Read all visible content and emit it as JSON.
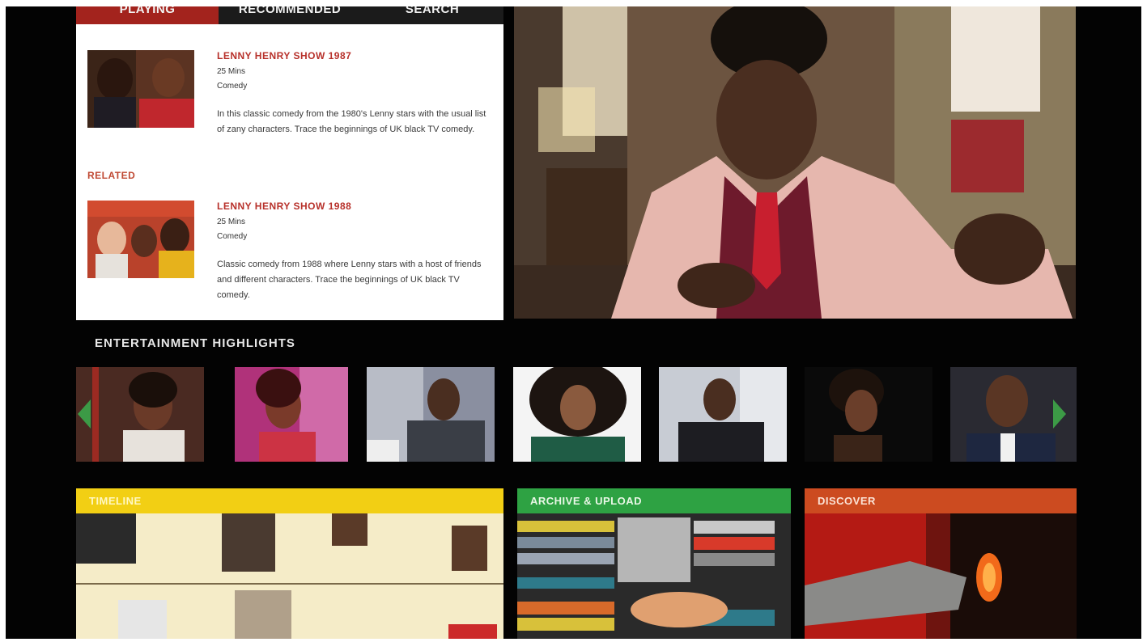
{
  "tabs": [
    {
      "label": "PLAYING"
    },
    {
      "label": "RECOMMENDED"
    },
    {
      "label": "SEARCH"
    }
  ],
  "now_playing": {
    "title": "LENNY HENRY SHOW 1987",
    "duration": "25 Mins",
    "genre": "Comedy",
    "description": "In this classic comedy from the 1980's Lenny stars with the usual list of zany characters. Trace the beginnings of UK black TV comedy."
  },
  "related_label": "RELATED",
  "related": {
    "title": "LENNY HENRY SHOW 1988",
    "duration": "25 Mins",
    "genre": "Comedy",
    "description": "Classic comedy from 1988 where Lenny stars with a host of friends and different characters. Trace the beginnings of UK black TV comedy."
  },
  "highlights": {
    "title": "ENTERTAINMENT HIGHLIGHTS",
    "prev_icon": "arrow-left-icon",
    "next_icon": "arrow-right-icon"
  },
  "tiles": [
    {
      "label": "TIMELINE",
      "color": "#f2cf14"
    },
    {
      "label": "ARCHIVE & UPLOAD",
      "color": "#2ea243"
    },
    {
      "label": "DISCOVER",
      "color": "#cc4b20"
    }
  ],
  "colors": {
    "accent_red": "#a3231d",
    "highlight_green": "#3c9a46",
    "background": "#030303"
  }
}
